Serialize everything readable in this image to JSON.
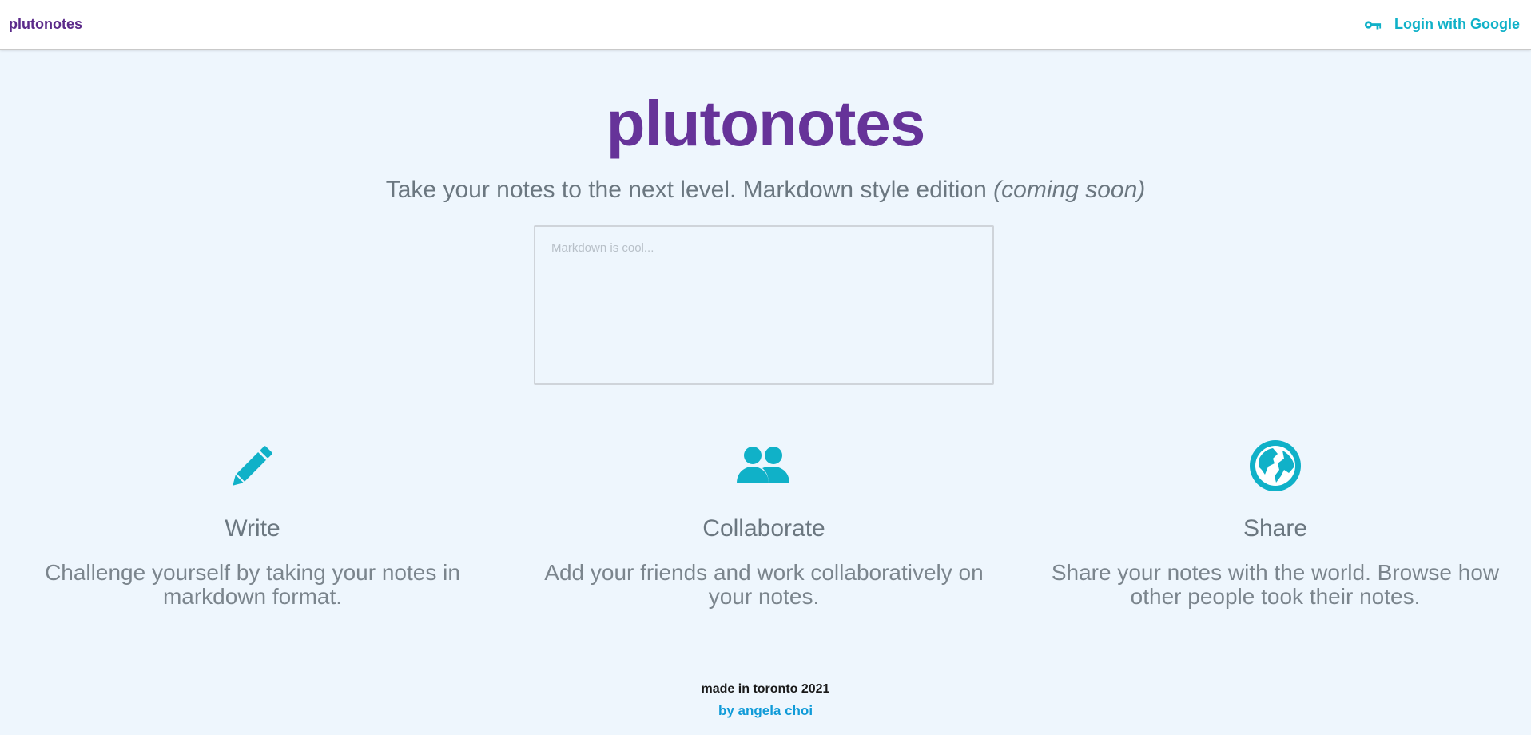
{
  "navbar": {
    "brand": "plutonotes",
    "login_label": "Login with Google",
    "login_icon": "key-icon"
  },
  "hero": {
    "title": "plutonotes",
    "subtitle": "Take your notes to the next level. Markdown style edition",
    "subtitle_emphasis": "(coming soon)"
  },
  "editor": {
    "placeholder": "Markdown is cool...",
    "value": ""
  },
  "features": [
    {
      "icon": "pencil-icon",
      "title": "Write",
      "description": "Challenge yourself by taking your notes in markdown format."
    },
    {
      "icon": "people-icon",
      "title": "Collaborate",
      "description": "Add your friends and work collaboratively on your notes."
    },
    {
      "icon": "globe-icon",
      "title": "Share",
      "description": "Share your notes with the world. Browse how other people took their notes."
    }
  ],
  "footer": {
    "made": "made in toronto 2021",
    "author": "by angela choi"
  },
  "colors": {
    "brand_purple": "#663399",
    "accent_cyan": "#10b1c8",
    "background": "#eef6fd",
    "link_blue": "#109bd8"
  }
}
